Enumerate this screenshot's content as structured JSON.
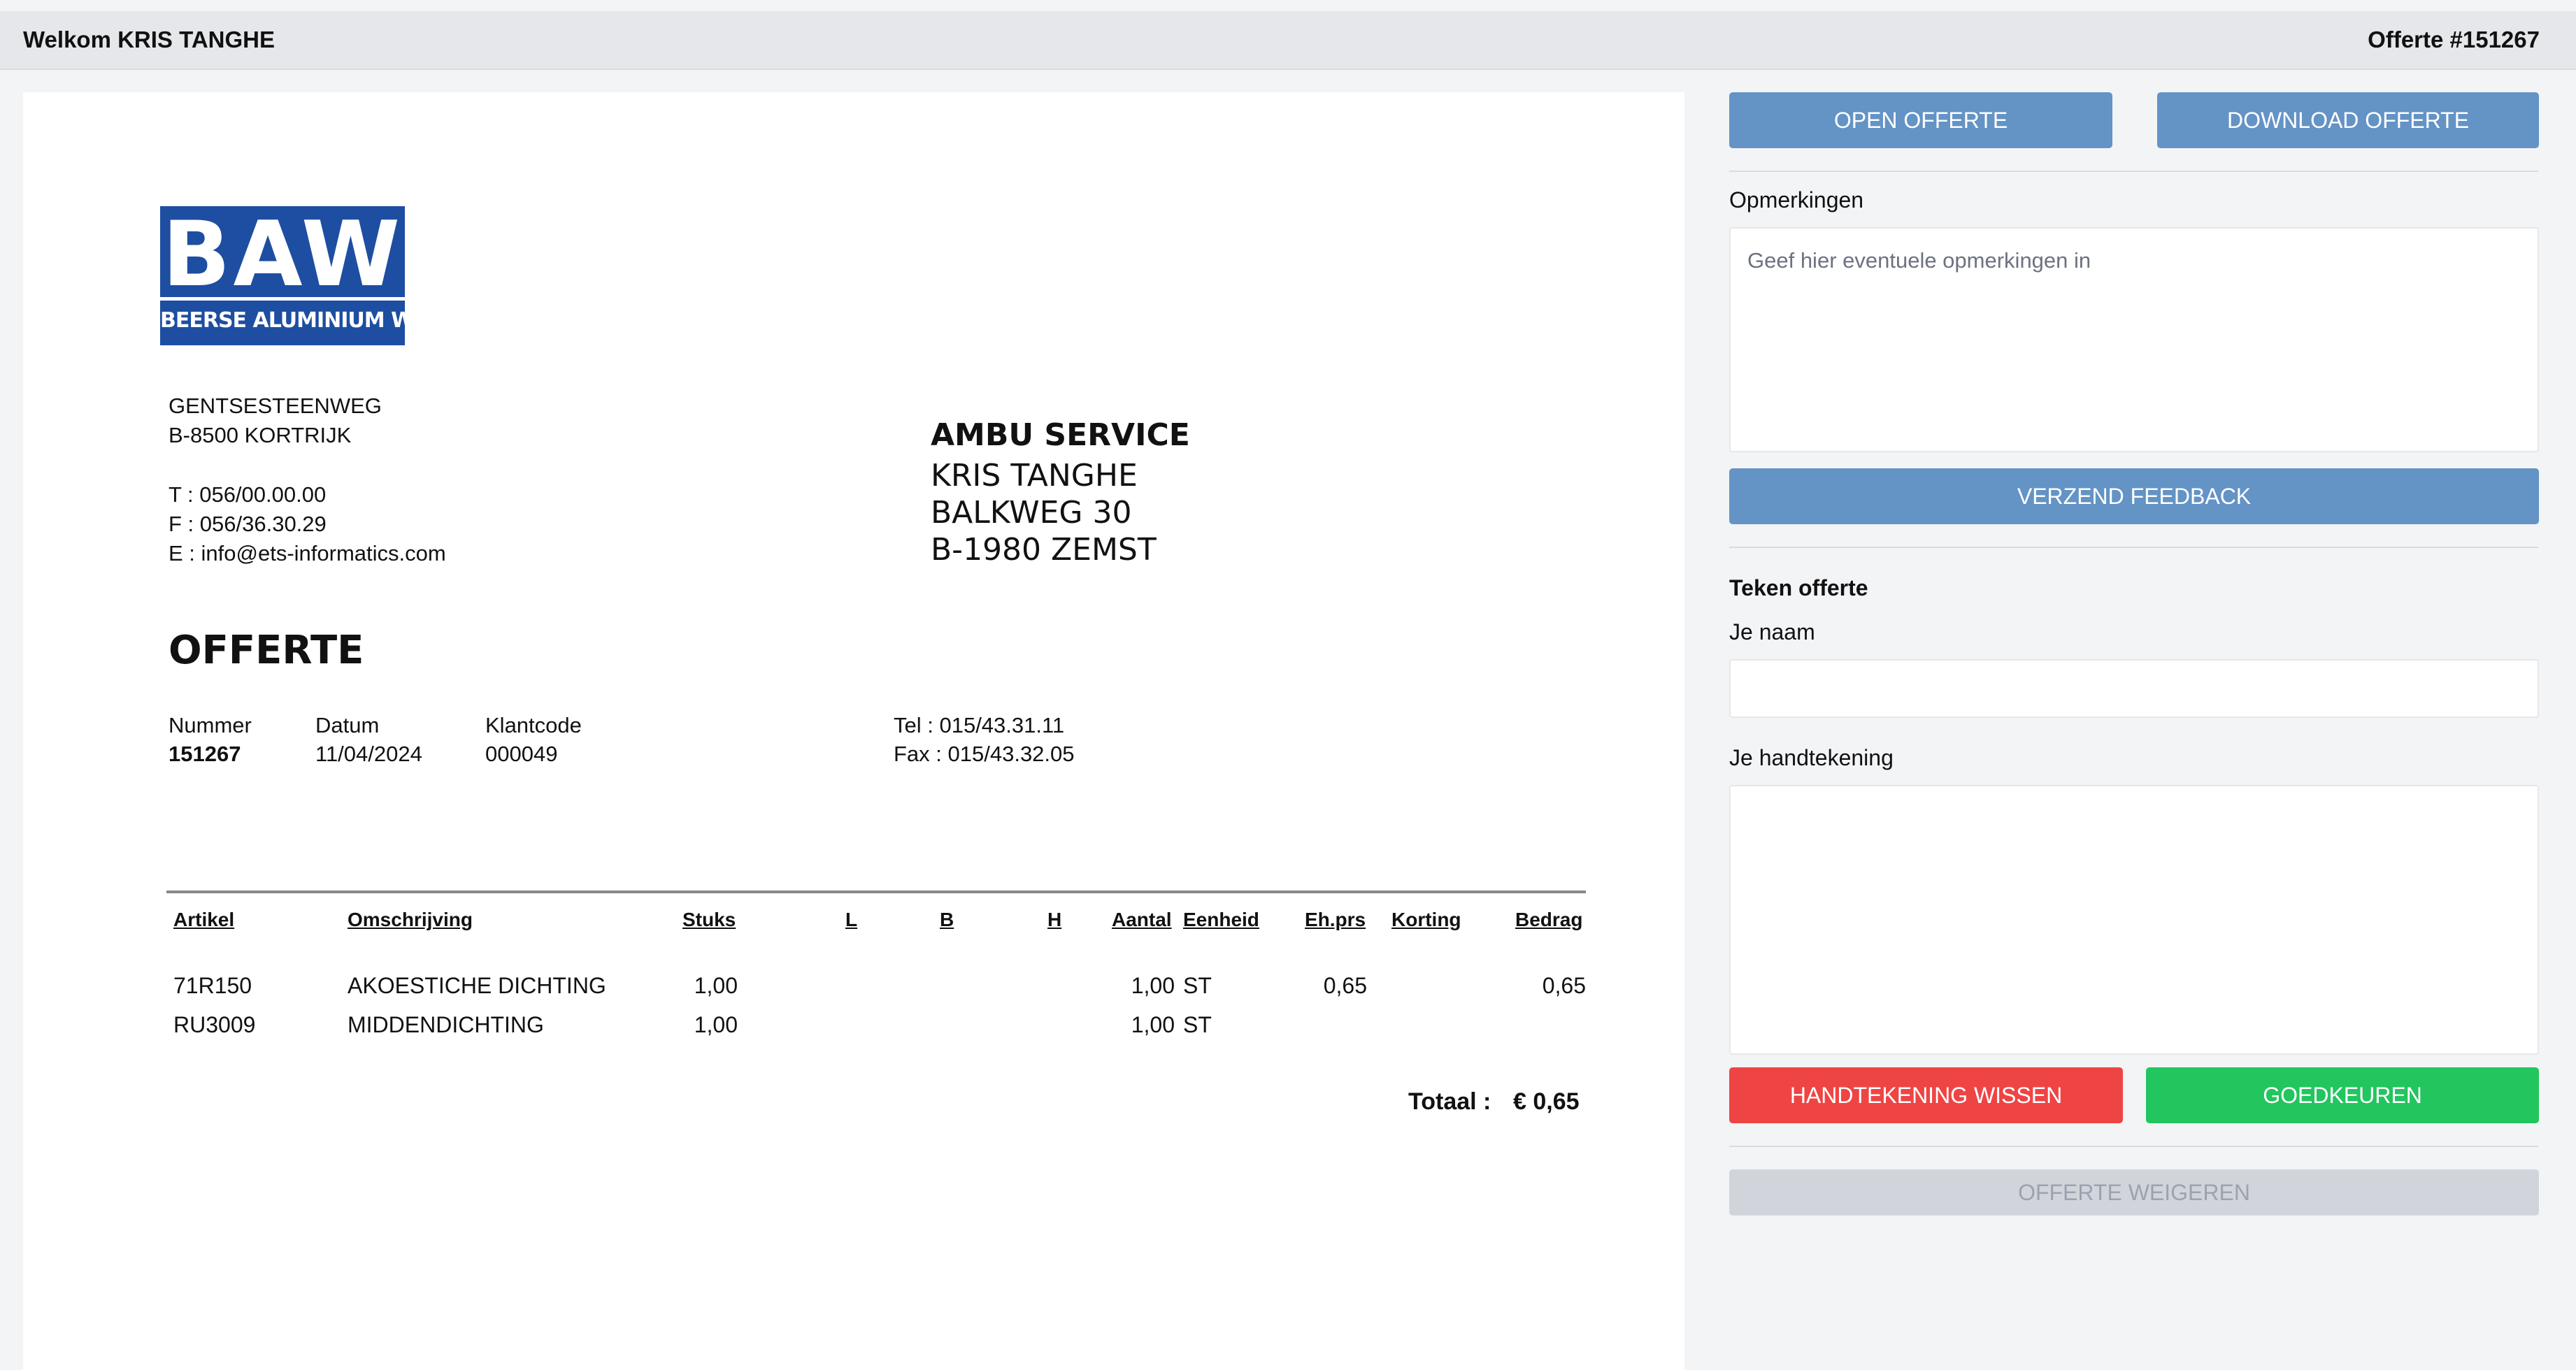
{
  "header": {
    "welcome": "Welkom KRIS TANGHE",
    "quote_number": "Offerte #151267"
  },
  "document": {
    "logo": {
      "big": "BAW",
      "small": "BEERSE ALUMINIUM WERKEN"
    },
    "company_address": [
      "GENTSESTEENWEG",
      "B-8500 KORTRIJK",
      "T : 056/00.00.00",
      "F : 056/36.30.29",
      "E : info@ets-informatics.com"
    ],
    "customer": {
      "name": "AMBU SERVICE",
      "contact": "KRIS TANGHE",
      "street": "BALKWEG 30",
      "city": "B-1980  ZEMST"
    },
    "title": "OFFERTE",
    "meta": {
      "number_label": "Nummer",
      "number": "151267",
      "date_label": "Datum",
      "date": "11/04/2024",
      "client_label": "Klantcode",
      "client": "000049",
      "tel": "Tel : 015/43.31.11",
      "fax": "Fax : 015/43.32.05"
    },
    "table": {
      "headers": [
        "Artikel",
        "Omschrijving",
        "Stuks",
        "L",
        "B",
        "H",
        "Aantal",
        "Eenheid",
        "Eh.prs",
        "Korting",
        "Bedrag"
      ],
      "rows": [
        {
          "artikel": "71R150",
          "omschrijving": "AKOESTICHE DICHTING",
          "stuks": "1,00",
          "aantal": "1,00",
          "eenheid": "ST",
          "ehprs": "0,65",
          "korting": "",
          "bedrag": "0,65"
        },
        {
          "artikel": "RU3009",
          "omschrijving": "MIDDENDICHTING",
          "stuks": "1,00",
          "aantal": "1,00",
          "eenheid": "ST",
          "ehprs": "",
          "korting": "",
          "bedrag": ""
        }
      ]
    },
    "total_label": "Totaal :",
    "total_value": "€ 0,65"
  },
  "sidebar": {
    "open_label": "OPEN OFFERTE",
    "download_label": "DOWNLOAD OFFERTE",
    "remarks_label": "Opmerkingen",
    "remarks_placeholder": "Geef hier eventuele opmerkingen in",
    "send_feedback_label": "VERZEND FEEDBACK",
    "sign_title": "Teken offerte",
    "name_label": "Je naam",
    "name_value": "",
    "signature_label": "Je handtekening",
    "clear_signature_label": "HANDTEKENING WISSEN",
    "approve_label": "GOEDKEUREN",
    "reject_label": "OFFERTE WEIGEREN"
  },
  "colors": {
    "primary_button": "#6493c5",
    "danger_button": "#ef4444",
    "success_button": "#22c55e",
    "disabled_button": "#d1d5db",
    "logo_blue": "#1d4ea1"
  }
}
